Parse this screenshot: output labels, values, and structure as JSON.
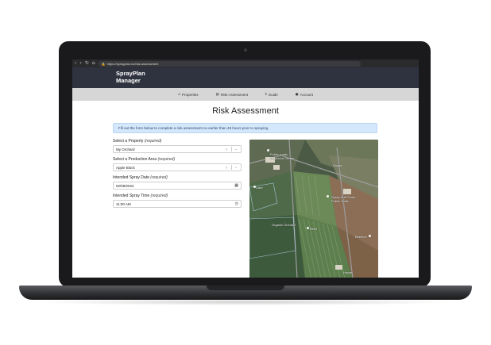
{
  "browser": {
    "url": "https://sprayplan.nz/risk-assessment",
    "back_icon": "back-arrow-icon",
    "forward_icon": "forward-arrow-icon",
    "reload_icon": "reload-icon",
    "home_icon": "home-icon"
  },
  "app": {
    "brand_line1": "SprayPlan",
    "brand_line2": "Manager",
    "header_color": "#2f3340"
  },
  "nav": {
    "items": [
      {
        "label": "Properties",
        "icon": "home-icon"
      },
      {
        "label": "Risk Assessment",
        "icon": "clipboard-icon"
      },
      {
        "label": "Guide",
        "icon": "info-icon"
      },
      {
        "label": "Account",
        "icon": "user-icon"
      }
    ]
  },
  "page": {
    "title": "Risk Assessment",
    "alert": "Fill out the form below to complete a risk assessment no earlier than 48 hours prior to spraying."
  },
  "form": {
    "required_tag": "(required)",
    "property_label": "Select a Property",
    "property_value": "My Orchard",
    "area_label": "Select a Production Area",
    "area_value": "Apple Block",
    "date_label": "Intended Spray Date",
    "date_value": "02/09/2022",
    "time_label": "Intended Spray Time",
    "time_value": "11:00 AM"
  },
  "map": {
    "labels": [
      "Public roads",
      "Research Centre",
      "House",
      "Lake",
      "Spray Drift Track",
      "Public Trails",
      "Organic Orchard",
      "Bees",
      "Beehive",
      "House"
    ]
  }
}
